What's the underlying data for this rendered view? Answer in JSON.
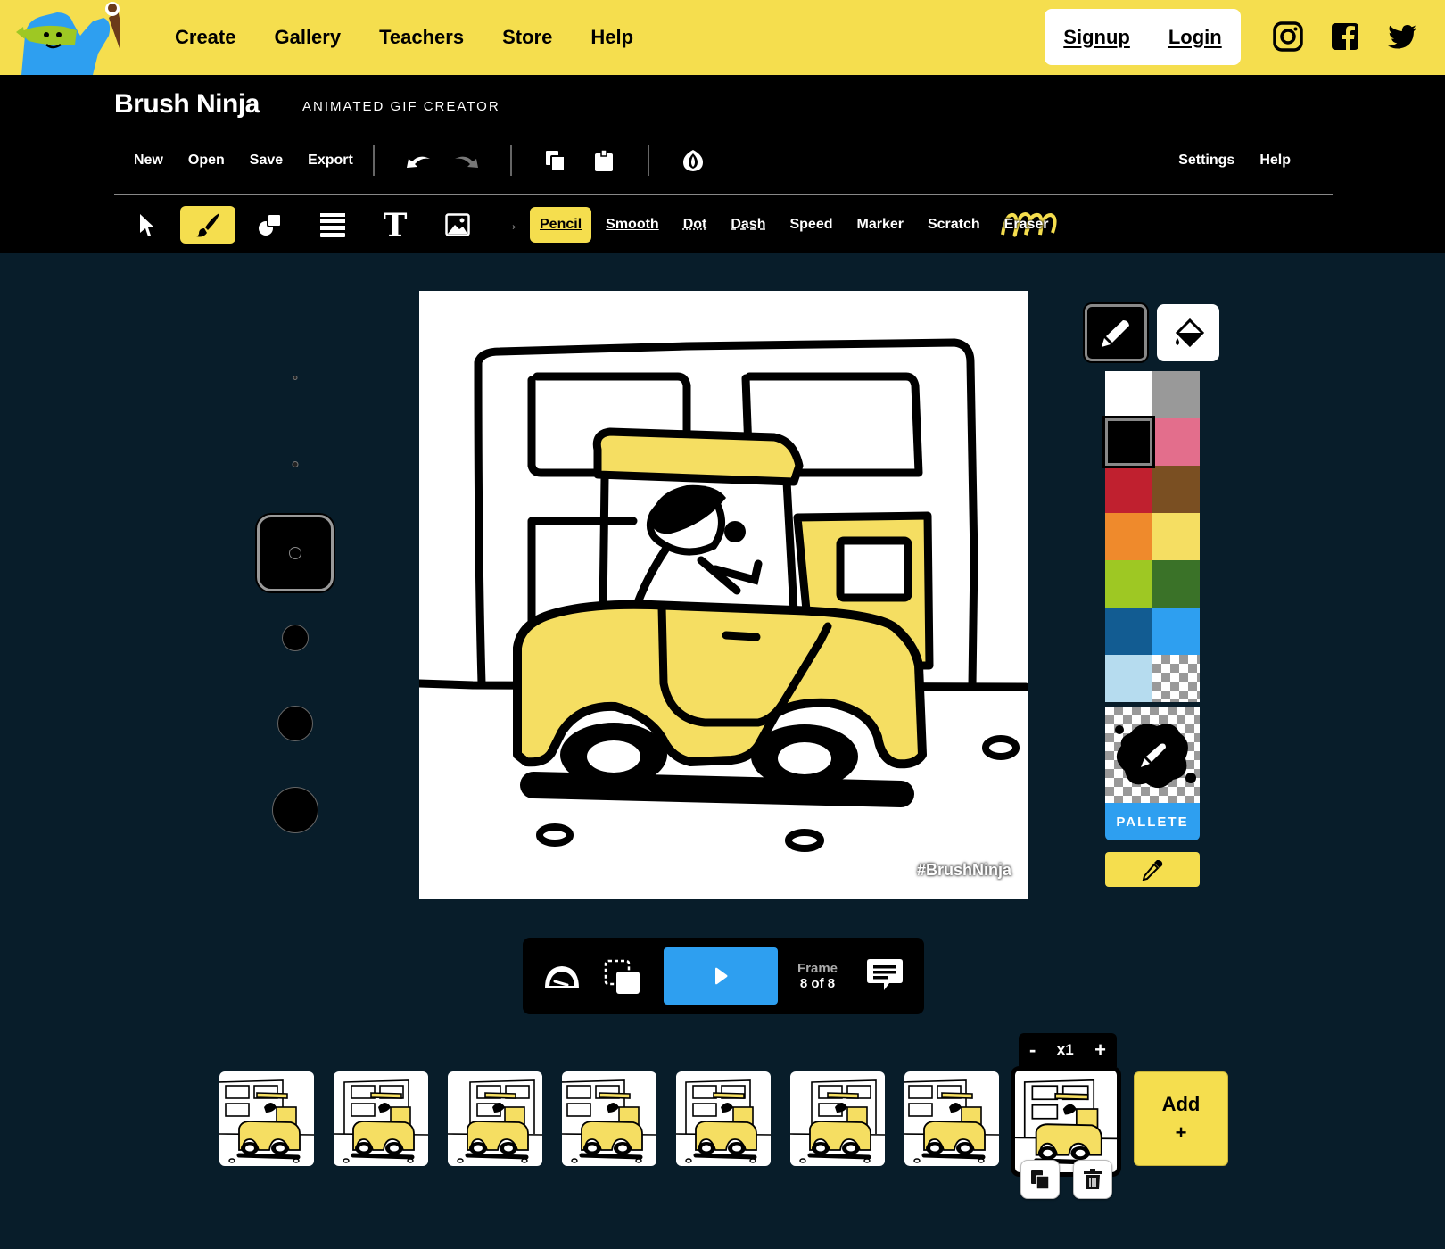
{
  "topnav": {
    "links": [
      "Create",
      "Gallery",
      "Teachers",
      "Store",
      "Help"
    ],
    "signup": "Signup",
    "login": "Login",
    "social": [
      "instagram-icon",
      "facebook-icon",
      "twitter-icon"
    ]
  },
  "header": {
    "brand": "Brush Ninja",
    "subtitle": "ANIMATED GIF CREATOR",
    "menu": [
      "New",
      "Open",
      "Save",
      "Export"
    ],
    "icons": [
      "undo-icon",
      "redo-icon",
      "copy-icon",
      "paste-icon",
      "onion-skin-icon"
    ],
    "right_menu": [
      "Settings",
      "Help"
    ]
  },
  "tools": {
    "items": [
      "select-tool",
      "brush-tool",
      "shapes-tool",
      "layers-tool",
      "text-tool",
      "image-tool"
    ],
    "active": "brush-tool",
    "brushes": [
      "Pencil",
      "Smooth",
      "Dot",
      "Dash",
      "Speed",
      "Marker",
      "Scratch",
      "Eraser"
    ],
    "active_brush": "Pencil"
  },
  "brush_sizes": {
    "count": 6,
    "selected_index": 2
  },
  "canvas": {
    "watermark": "#BrushNinja"
  },
  "palette": {
    "modes": [
      "pencil-mode",
      "fill-mode"
    ],
    "active_mode": "pencil-mode",
    "colors": [
      "#ffffff",
      "#999999",
      "#000000",
      "#e36e8c",
      "#c0202f",
      "#7a4f22",
      "#ef8a2c",
      "#f5de62",
      "#9ec823",
      "#3a7228",
      "#125c92",
      "#2e9ff0",
      "#b6dcef",
      "transparent"
    ],
    "selected_color": "#000000",
    "pallete_label": "PALLETE"
  },
  "playback": {
    "frame_label": "Frame",
    "frame_value": "8 of 8"
  },
  "timeline": {
    "frame_count": 8,
    "selected_frame": 8,
    "duration": "x1",
    "minus": "-",
    "plus": "+",
    "add_label": "Add",
    "add_plus": "+"
  },
  "colors": {
    "brand_yellow": "#f5de4e",
    "accent_blue": "#2e9ff0",
    "bg": "#081d2a"
  }
}
